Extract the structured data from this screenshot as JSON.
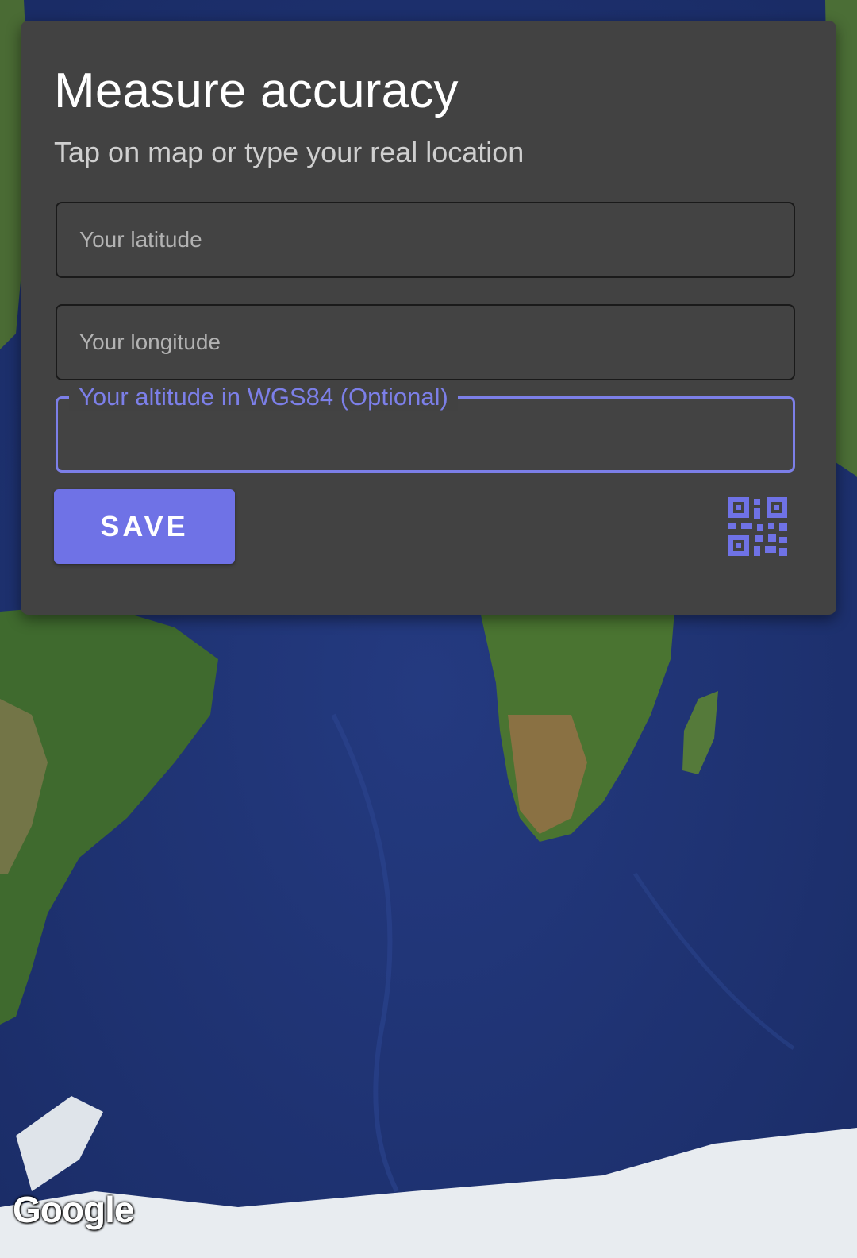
{
  "dialog": {
    "title": "Measure accuracy",
    "subtitle": "Tap on map or type your real location"
  },
  "fields": {
    "latitude": {
      "placeholder": "Your latitude",
      "value": ""
    },
    "longitude": {
      "placeholder": "Your longitude",
      "value": ""
    },
    "altitude": {
      "label": "Your altitude in WGS84 (Optional)",
      "value": "",
      "focused": true
    }
  },
  "actions": {
    "save_label": "SAVE",
    "qr_icon": "qr-code-icon"
  },
  "map": {
    "attribution": "Google",
    "type": "satellite"
  },
  "colors": {
    "accent": "#6f72e6",
    "dialog_background": "#424242",
    "ocean": "#1f3473"
  }
}
